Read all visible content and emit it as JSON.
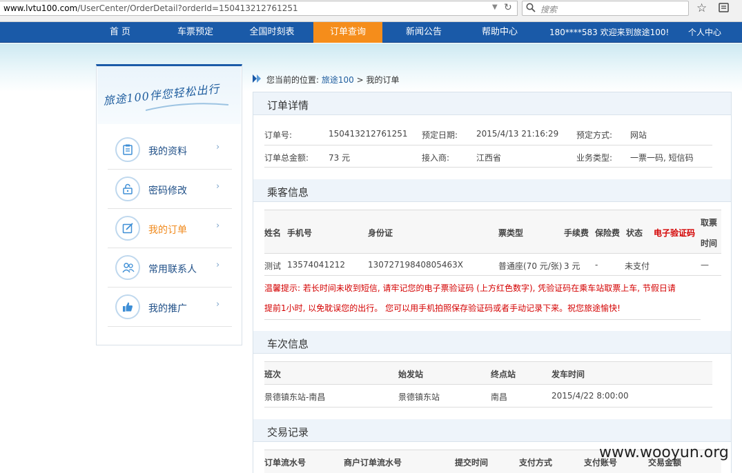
{
  "browser": {
    "url_host": "www.lvtu100.com",
    "url_path": "/UserCenter/OrderDetail?orderId=150413212761251",
    "search_placeholder": "搜索"
  },
  "nav": {
    "items": [
      "首 页",
      "车票预定",
      "全国时刻表",
      "订单查询",
      "新闻公告",
      "帮助中心"
    ],
    "active": "订单查询",
    "welcome": "180****583 欢迎来到旅途100!",
    "user_center": "个人中心"
  },
  "sidebar": {
    "slogan": "旅途100伴您轻松出行",
    "items": [
      {
        "label": "我的资料",
        "icon": "profile-icon"
      },
      {
        "label": "密码修改",
        "icon": "lock-icon"
      },
      {
        "label": "我的订单",
        "icon": "edit-order-icon",
        "active": true
      },
      {
        "label": "常用联系人",
        "icon": "contacts-icon"
      },
      {
        "label": "我的推广",
        "icon": "thumbs-up-icon"
      }
    ]
  },
  "breadcrumb": {
    "prefix": "您当前的位置:",
    "home": "旅途100",
    "sep": ">",
    "current": "我的订单"
  },
  "order": {
    "title": "订单详情",
    "order_no_label": "订单号:",
    "order_no": "150413212761251",
    "date_label": "预定日期:",
    "date": "2015/4/13 21:16:29",
    "method_label": "预定方式:",
    "method": "网站",
    "total_label": "订单总金额:",
    "total": "73 元",
    "provider_label": "接入商:",
    "provider": "江西省",
    "biz_label": "业务类型:",
    "biz": "一票一码, 短信码"
  },
  "passenger": {
    "title": "乘客信息",
    "headers": [
      "姓名",
      "手机号",
      "身份证",
      "票类型",
      "手续费",
      "保险费",
      "状态",
      "电子验证码",
      "取票",
      "时间"
    ],
    "row": {
      "name": "测试",
      "phone": "13574041212",
      "id": "13072719840805463X",
      "ticket_type": "普通座(70 元/张)",
      "fee": "3 元",
      "insurance": "-",
      "status": "未支付",
      "code": "",
      "pickup_time": "—"
    },
    "tip_line1": "温馨提示: 若长时间未收到短信, 请牢记您的电子票验证码 (上方红色数字), 凭验证码在乘车站取票上车, 节假日请",
    "tip_line2": "提前1小时, 以免耽误您的出行。 您可以用手机拍照保存验证码或者手动记录下来。祝您旅途愉快!"
  },
  "trip": {
    "title": "车次信息",
    "headers": [
      "班次",
      "始发站",
      "终点站",
      "发车时间"
    ],
    "row": {
      "train": "景德镇东站-南昌",
      "from": "景德镇东站",
      "to": "南昌",
      "time": "2015/4/22 8:00:00"
    }
  },
  "transactions": {
    "title": "交易记录",
    "headers": [
      "订单流水号",
      "商户订单流水号",
      "提交时间",
      "支付方式",
      "支付账号",
      "交易金额"
    ]
  },
  "watermark": "www.wooyun.org",
  "colors": {
    "nav_bg": "#1a5aa8",
    "nav_active": "#f58d1b",
    "alert_red": "#d40000",
    "link_blue": "#1f5d9e"
  }
}
